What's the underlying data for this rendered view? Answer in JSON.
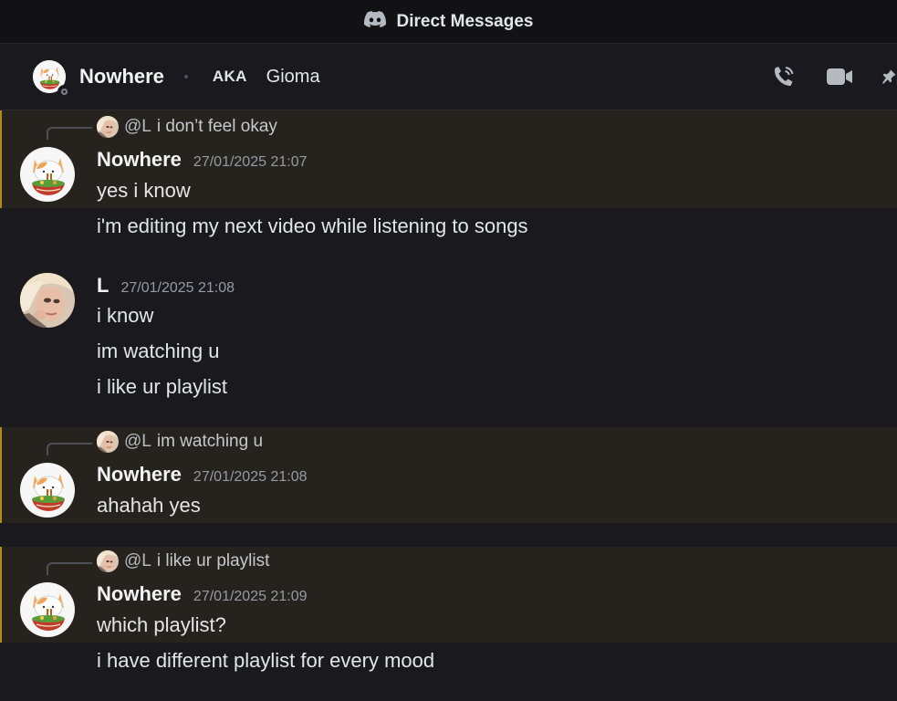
{
  "titlebar": {
    "title": "Direct Messages",
    "icon": "discord-logo-icon"
  },
  "header": {
    "name": "Nowhere",
    "aka_label": "AKA",
    "nickname": "Gioma",
    "status": "offline",
    "icons": [
      "phone-call-icon",
      "video-call-icon",
      "pin-icon"
    ]
  },
  "colors": {
    "background": "#1a1a1e",
    "titlebar": "#121214",
    "highlight": "#26231f",
    "highlight_border": "#b08a1e",
    "author": "#f2f3f5",
    "timestamp": "#949ba4"
  },
  "messages": [
    {
      "reply_to": {
        "mention": "@L",
        "text": "i don’t feel okay"
      },
      "author": "Nowhere",
      "time": "27/01/2025 21:07",
      "lines": [
        "yes i know"
      ]
    },
    {
      "continuation": true,
      "lines": [
        "i'm editing my next video while listening to songs"
      ]
    },
    {
      "author": "L",
      "time": "27/01/2025 21:08",
      "lines": [
        "i know",
        "im watching u",
        "i like ur playlist"
      ]
    },
    {
      "reply_to": {
        "mention": "@L",
        "text": "im watching u"
      },
      "author": "Nowhere",
      "time": "27/01/2025 21:08",
      "lines": [
        "ahahah yes"
      ]
    },
    {
      "reply_to": {
        "mention": "@L",
        "text": "i like ur playlist"
      },
      "author": "Nowhere",
      "time": "27/01/2025 21:09",
      "lines": [
        "which playlist?"
      ]
    },
    {
      "continuation": true,
      "lines": [
        "i have different playlist for every mood"
      ]
    }
  ]
}
